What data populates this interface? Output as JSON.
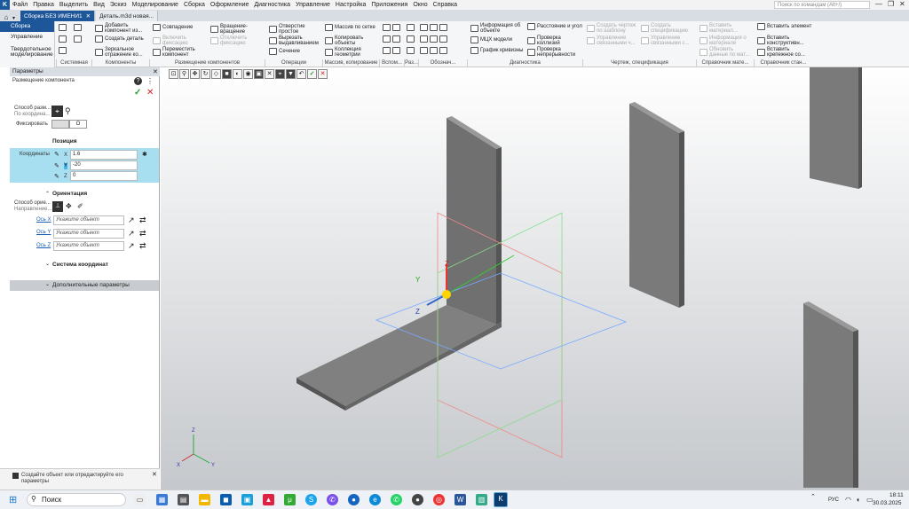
{
  "menubar": {
    "items": [
      "Файл",
      "Правка",
      "Выделить",
      "Вид",
      "Эскиз",
      "Моделирование",
      "Сборка",
      "Оформление",
      "Диагностика",
      "Управление",
      "Настройка",
      "Приложения",
      "Окно",
      "Справка"
    ],
    "search_placeholder": "Поиск по командам (Alt+/)"
  },
  "tabs": [
    {
      "label": "Сборка БЕЗ ИМЕНИ1"
    },
    {
      "label": "Деталь.m3d новая..."
    }
  ],
  "modes": [
    "Сборка",
    "Управление",
    "Твердотельное моделирование"
  ],
  "ribbon": {
    "sys_buttons": [
      "Добавить компонент из...",
      "Создать деталь",
      "Зеркальное отражение ко..."
    ],
    "place": [
      "Совпадение",
      "Включить фиксацию",
      "Переместить компонент",
      "Вращение-вращение",
      "Отключить фиксацию"
    ],
    "ops": [
      "Отверстие простое",
      "Вырезать выдавливанием",
      "Сечение"
    ],
    "array": [
      "Массив по сетке",
      "Копировать объекты",
      "Коллекция геометрии"
    ],
    "diag": [
      "Информация об объекте",
      "МЦХ модели",
      "График кривизны",
      "Расстояние и угол",
      "Проверка коллизий",
      "Проверка непрерывности"
    ],
    "draw": [
      "Создать чертеж по шаблону",
      "Управление связанными ч...",
      "Создать спецификацию",
      "Управление связанными с..."
    ],
    "ref": [
      "Вставить материал...",
      "Информация о материале",
      "Обновить данные по мат..."
    ],
    "std": [
      "Вставить элемент",
      "Вставить конструктивн...",
      "Вставить крепежное со..."
    ],
    "groups": [
      "Системная",
      "Компоненты",
      "Размещение компонентов",
      "Операции",
      "Массив, копирование",
      "Вспом...",
      "Раз...",
      "Обознач...",
      "Диагностика",
      "Чертеж, спецификация",
      "Справочник мате...",
      "Справочник стан..."
    ]
  },
  "params": {
    "title": "Параметры",
    "subtitle": "Размещение компонента",
    "method_label": "Способ разм...",
    "method_sub": "По координа...",
    "fix_label": "Фиксировать",
    "position": "Позиция",
    "coords_label": "Координаты",
    "x_label": "X",
    "x": "1.6",
    "y_label": "Y",
    "y": "-20",
    "z_label": "Z",
    "z": "0",
    "orientation": "Ориентация",
    "orient_method": "Способ орие...",
    "orient_dir": "Направление...",
    "axis_x": "Ось X",
    "axis_y": "Ось Y",
    "axis_z": "Ось Z",
    "pick_placeholder": "Укажите объект",
    "cs": "Система координат",
    "extra": "Дополнительные параметры"
  },
  "status": "Создайте объект или отредактируйте его параметры",
  "taskbar": {
    "search": "Поиск",
    "lang": "РУС",
    "time": "18:11",
    "date": "30.03.2025"
  },
  "colors": {
    "accent": "#1e5799",
    "highlight": "#a8dff0"
  }
}
